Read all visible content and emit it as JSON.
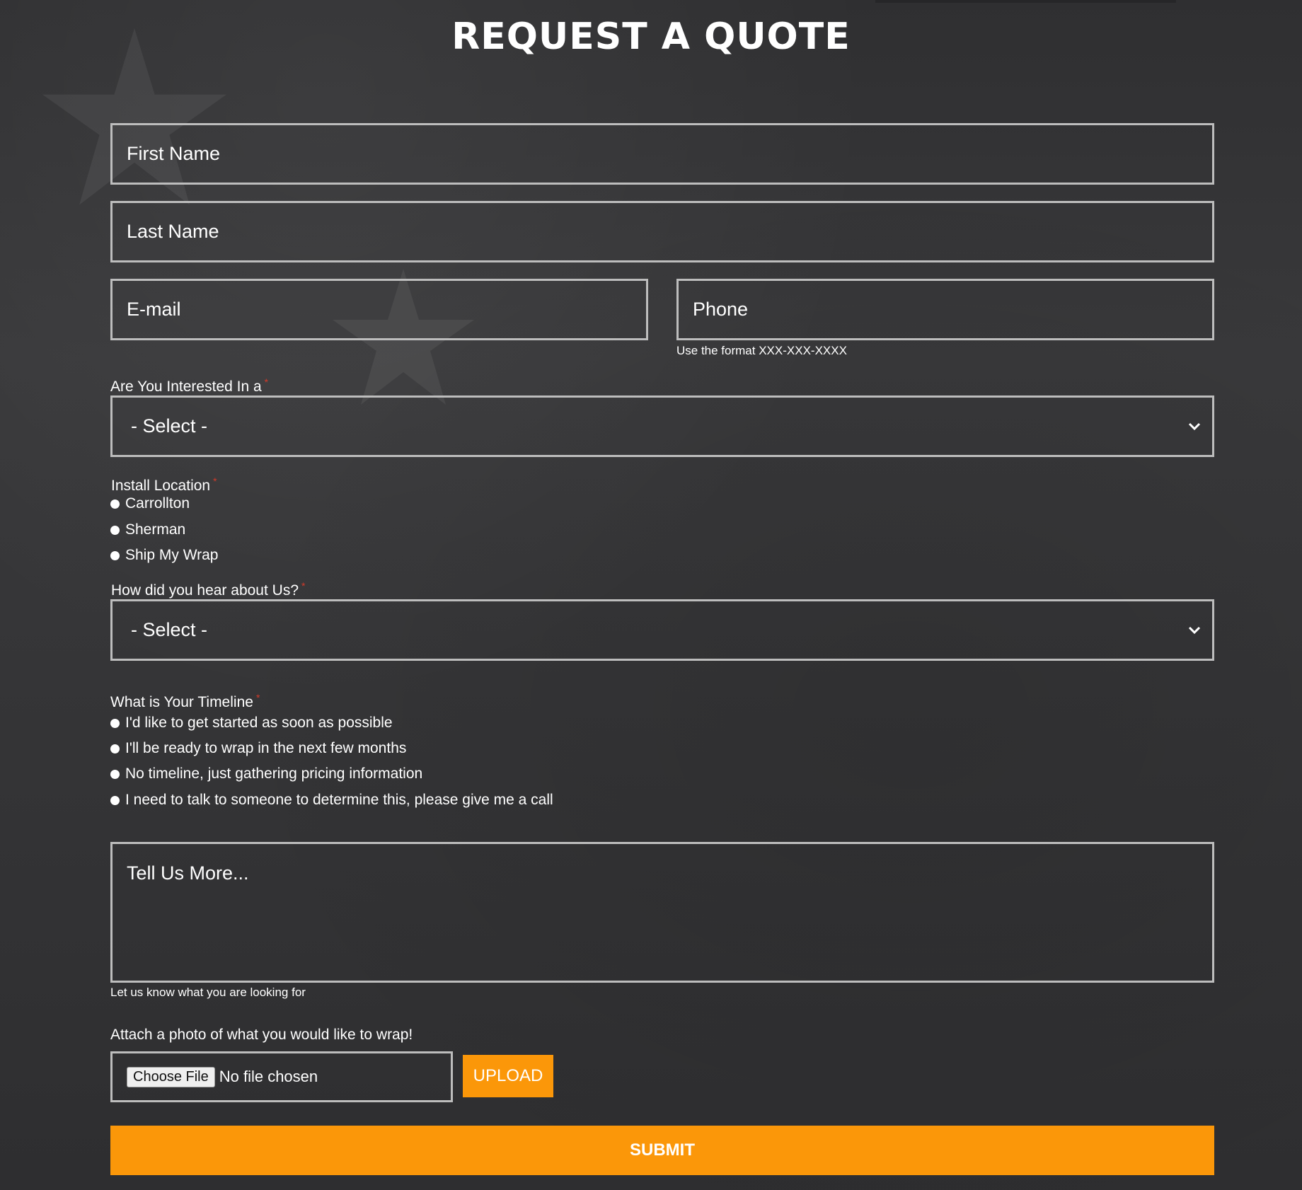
{
  "header": {
    "title": "REQUEST A QUOTE"
  },
  "form": {
    "first_name": {
      "placeholder": "First Name",
      "value": ""
    },
    "last_name": {
      "placeholder": "Last Name",
      "value": ""
    },
    "email": {
      "placeholder": "E-mail",
      "value": ""
    },
    "phone": {
      "placeholder": "Phone",
      "value": "",
      "hint": "Use the format XXX-XXX-XXXX"
    },
    "interest": {
      "label": "Are You Interested In a",
      "required_mark": "*",
      "selected": "- Select -"
    },
    "install_location": {
      "label": "Install Location",
      "required_mark": "*",
      "options": [
        "Carrollton",
        "Sherman",
        "Ship My Wrap"
      ]
    },
    "referral": {
      "label": "How did you hear about Us?",
      "required_mark": "*",
      "selected": "- Select -"
    },
    "timeline": {
      "label": "What is Your Timeline",
      "required_mark": "*",
      "options": [
        "I'd like to get started as soon as possible",
        "I'll be ready to wrap in the next few months",
        "No timeline, just gathering pricing information",
        "I need to talk to someone to determine this, please give me a call"
      ]
    },
    "message": {
      "placeholder": "Tell Us More...",
      "value": "",
      "hint": "Let us know what you are looking for"
    },
    "attachment": {
      "label": "Attach a photo of what you would like to wrap!",
      "choose_label": "Choose File",
      "status": "No file chosen",
      "upload_label": "UPLOAD"
    },
    "submit_label": "SUBMIT"
  },
  "colors": {
    "background": "#343436",
    "field_border": "#bdbdbd",
    "accent": "#fb9709",
    "required": "#d23a2a"
  },
  "icons": {
    "select_arrow": "chevron-down-icon",
    "radio": "radio-icon"
  }
}
